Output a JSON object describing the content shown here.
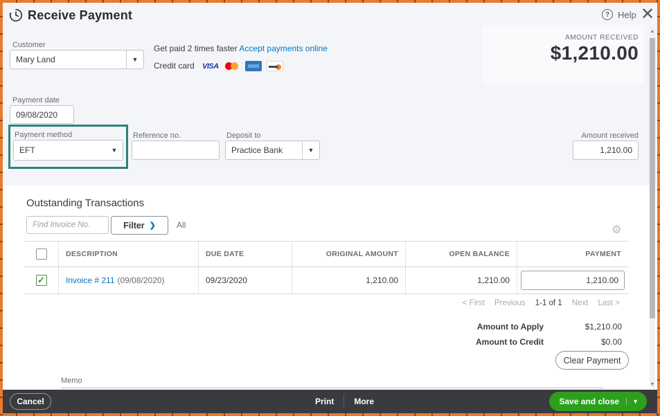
{
  "header": {
    "title": "Receive Payment",
    "help_label": "Help",
    "close_glyph": "✕",
    "help_glyph": "?"
  },
  "summary": {
    "amount_received_label": "AMOUNT RECEIVED",
    "amount_received_value": "$1,210.00"
  },
  "customer": {
    "label": "Customer",
    "value": "Mary Land"
  },
  "promo": {
    "text": "Get paid 2 times faster",
    "link": "Accept payments online",
    "credit_card_label": "Credit card",
    "visa_text": "VISA",
    "cards": [
      "visa-icon",
      "mastercard-icon",
      "amex-icon",
      "discover-icon"
    ]
  },
  "fields": {
    "payment_date": {
      "label": "Payment date",
      "value": "09/08/2020"
    },
    "payment_method": {
      "label": "Payment method",
      "value": "EFT"
    },
    "reference_no": {
      "label": "Reference no.",
      "value": ""
    },
    "deposit_to": {
      "label": "Deposit to",
      "value": "Practice Bank"
    },
    "amount_received": {
      "label": "Amount received",
      "value": "1,210.00"
    }
  },
  "transactions": {
    "heading": "Outstanding Transactions",
    "find_placeholder": "Find Invoice No.",
    "filter_label": "Filter",
    "filter_chevron": "❯",
    "all_label": "All",
    "table": {
      "columns": [
        "DESCRIPTION",
        "DUE DATE",
        "ORIGINAL AMOUNT",
        "OPEN BALANCE",
        "PAYMENT"
      ],
      "rows": [
        {
          "checked": true,
          "check_glyph": "✓",
          "description_link": "Invoice # 211",
          "description_date": "(09/08/2020)",
          "due_date": "09/23/2020",
          "original_amount": "1,210.00",
          "open_balance": "1,210.00",
          "payment_value": "1,210.00"
        }
      ]
    },
    "pagination": {
      "first": "< First",
      "previous": "Previous",
      "range": "1-1 of 1",
      "next": "Next",
      "last": "Last >"
    }
  },
  "totals": {
    "apply_label": "Amount to Apply",
    "apply_value": "$1,210.00",
    "credit_label": "Amount to Credit",
    "credit_value": "$0.00",
    "clear_button": "Clear Payment"
  },
  "memo": {
    "label": "Memo"
  },
  "footer": {
    "cancel": "Cancel",
    "print": "Print",
    "more": "More",
    "save": "Save and close",
    "save_caret": "▼"
  },
  "colors": {
    "accent_green": "#2ca01c",
    "link_blue": "#0077c5",
    "highlight_teal": "#27847b",
    "frame_orange": "#e87b2e",
    "footer_dark": "#3a3b3f"
  }
}
